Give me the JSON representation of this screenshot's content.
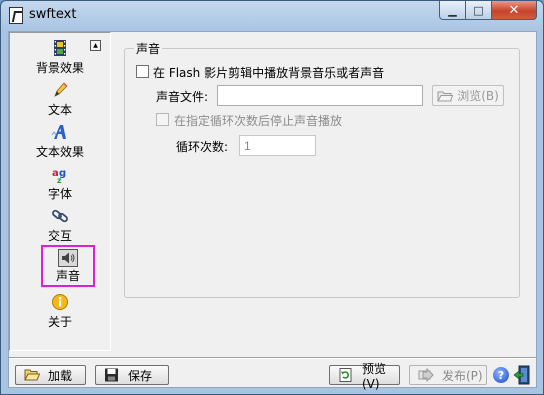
{
  "window": {
    "title": "swftext"
  },
  "titlebar_buttons": {
    "minimize": "▁",
    "maximize": "□",
    "close": "✕"
  },
  "sidebar": {
    "scroll_up": "▲",
    "items": [
      {
        "label": "背景效果",
        "icon": "film-icon"
      },
      {
        "label": "文本",
        "icon": "pencil-icon"
      },
      {
        "label": "文本效果",
        "icon": "text-effect-icon"
      },
      {
        "label": "字体",
        "icon": "font-icon"
      },
      {
        "label": "交互",
        "icon": "chain-link-icon"
      },
      {
        "label": "声音",
        "icon": "speaker-icon",
        "selected": true
      },
      {
        "label": "关于",
        "icon": "info-icon"
      }
    ]
  },
  "sound_panel": {
    "group_title": "声音",
    "play_bg_music_label": "在 Flash 影片剪辑中播放背景音乐或者声音",
    "play_bg_music_checked": false,
    "sound_file_label": "声音文件:",
    "sound_file_value": "",
    "browse_label": "浏览(B)",
    "stop_after_loops_label": "在指定循环次数后停止声音播放",
    "stop_after_loops_checked": false,
    "loop_count_label": "循环次数:",
    "loop_count_value": "1"
  },
  "bottom_bar": {
    "load_label": "加载",
    "save_label": "保存",
    "preview_label": "预览(V)",
    "publish_label": "发布(P)",
    "help_icon_glyph": "?"
  },
  "colors": {
    "selection_highlight": "#e020d0",
    "close_button": "#c6452d"
  }
}
